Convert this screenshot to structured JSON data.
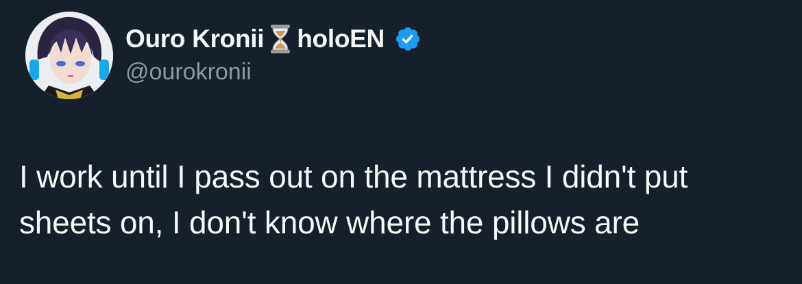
{
  "author": {
    "display_name_part1": "Ouro Kronii",
    "display_name_part2": "holoEN",
    "handle": "@ourokronii",
    "emoji_icon": "hourglass-icon",
    "verified": true,
    "verified_color": "#1d9bf0"
  },
  "tweet": {
    "lines": [
      "I work until I pass out on the mattress I didn't put",
      "sheets on, I don't know where the pillows are"
    ]
  },
  "colors": {
    "background": "#15202b",
    "text_primary": "#f7f9f9",
    "text_secondary": "#8b98a5"
  }
}
